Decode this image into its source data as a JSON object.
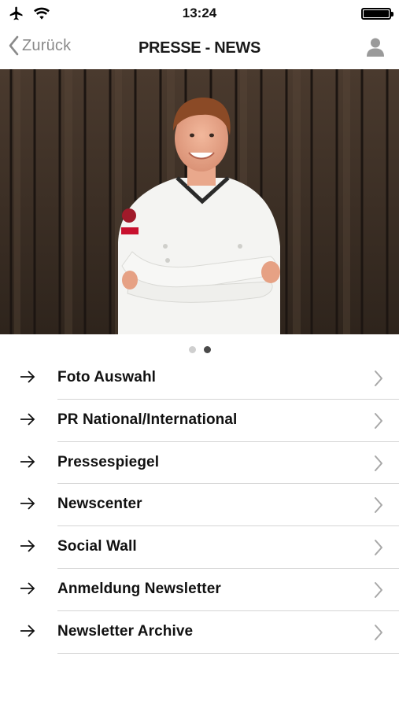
{
  "status_bar": {
    "time": "13:24",
    "icons": [
      "airplane-icon",
      "wifi-icon",
      "battery-icon"
    ]
  },
  "nav": {
    "back_label": "Zurück",
    "title": "PRESSE - NEWS",
    "back_icon": "chevron-left-icon",
    "profile_icon": "user-icon"
  },
  "carousel": {
    "page_count": 2,
    "active_page": 2
  },
  "menu": {
    "items": [
      {
        "label": "Foto Auswahl"
      },
      {
        "label": "PR National/International"
      },
      {
        "label": "Pressespiegel"
      },
      {
        "label": "Newscenter"
      },
      {
        "label": "Social Wall"
      },
      {
        "label": "Anmeldung Newsletter"
      },
      {
        "label": "Newsletter Archive"
      }
    ],
    "leading_icon": "arrow-right-icon",
    "trailing_icon": "chevron-right-icon"
  },
  "colors": {
    "accent_gray": "#8a8a8a",
    "divider": "#d4d4d4",
    "text": "#111111"
  }
}
